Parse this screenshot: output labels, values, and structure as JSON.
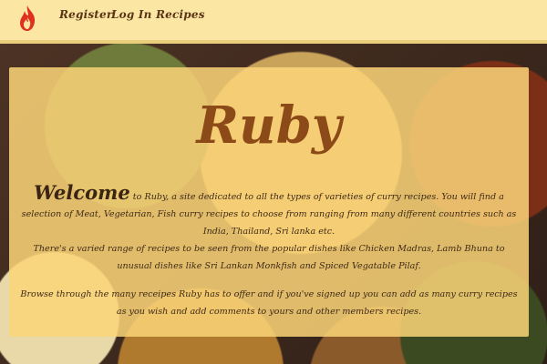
{
  "navbar": {
    "logo_icon": "flame-icon",
    "links": [
      {
        "label": "Register"
      },
      {
        "label": "Log In"
      },
      {
        "label": "Recipes"
      }
    ]
  },
  "main": {
    "title": "Ruby",
    "intro_lead": "Welcome",
    "intro_rest": " to Ruby, a site dedicated to all the types of varieties of curry recipes. You will find a selection of Meat, Vegetarian, Fish curry recipes to choose from ranging from many different countries such as India, Thailand, Sri lanka etc.",
    "para2": "There's a varied range of recipes to be seen from the popular dishes like Chicken Madras, Lamb Bhuna to unusual dishes like Sri Lankan Monkfish and Spiced Vegatable Pilaf.",
    "para3": "Browse through the many receipes Ruby has to offer and if you've signed up you can add as many curry recipes as you wish and add comments to yours and other members recipes."
  },
  "colors": {
    "navbar_bg": "#fbe7a3",
    "title": "#8b4a17",
    "panel": "#fad478",
    "flame": "#e0301e"
  }
}
